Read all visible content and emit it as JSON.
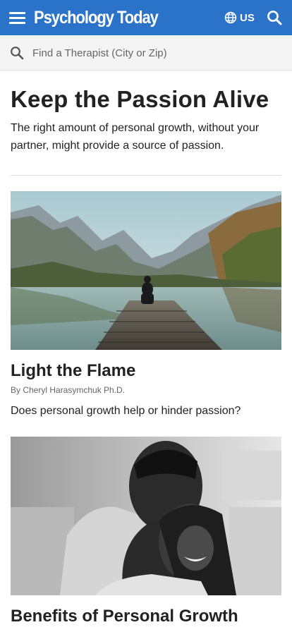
{
  "header": {
    "logo_text": "Psychology Today",
    "region_label": "US",
    "brand_color": "#2a73c9"
  },
  "search": {
    "placeholder": "Find a Therapist (City or Zip)"
  },
  "page": {
    "title": "Keep the Passion Alive",
    "subtitle": "The right amount of personal growth, without your partner, might provide a source of passion."
  },
  "articles": [
    {
      "title": "Light the Flame",
      "byline": "By Cheryl Harasymchuk Ph.D.",
      "teaser": "Does personal growth help or hinder passion?",
      "image": "person-on-dock-by-mountain-lake"
    },
    {
      "title": "Benefits of Personal Growth",
      "image": "couple-hugging-black-and-white"
    }
  ],
  "icons": {
    "menu": "hamburger-menu-icon",
    "globe": "globe-icon",
    "search": "search-icon"
  }
}
